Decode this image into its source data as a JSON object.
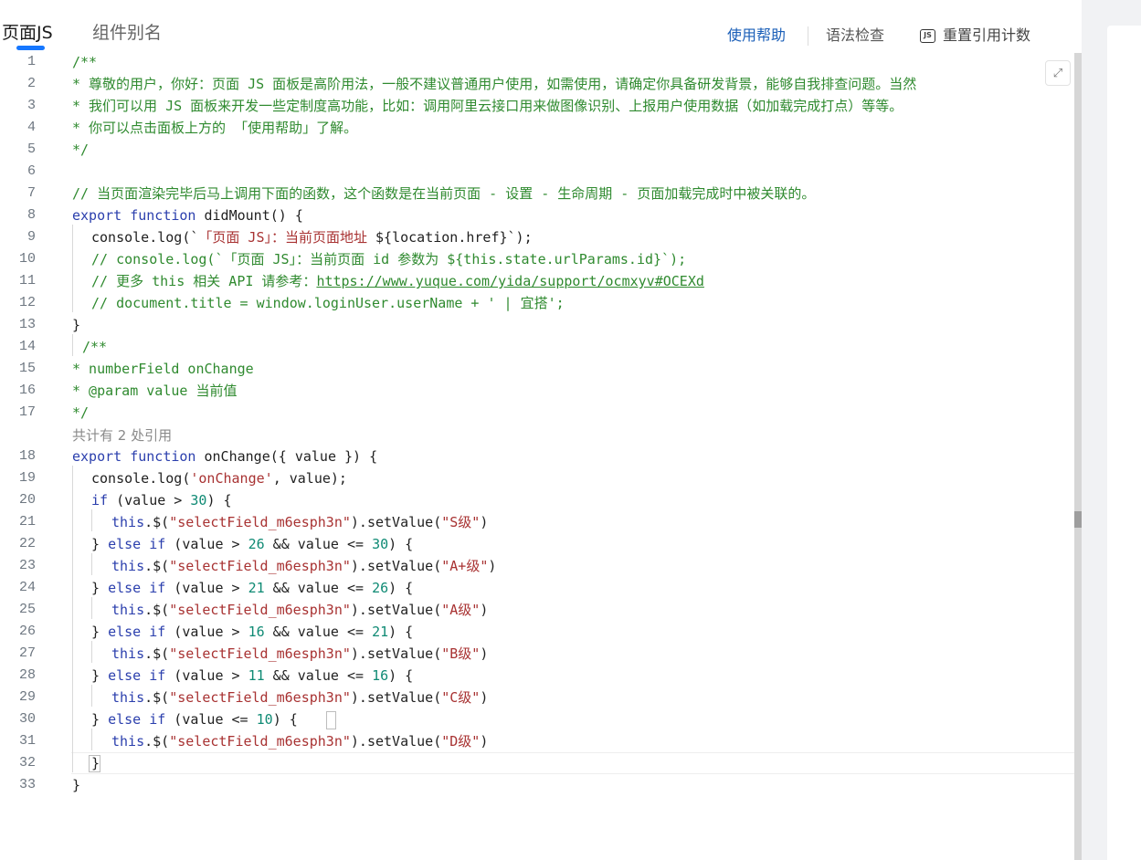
{
  "tabs": [
    {
      "label": "页面JS",
      "active": true
    },
    {
      "label": "组件别名",
      "active": false
    }
  ],
  "toolbar": {
    "help": "使用帮助",
    "lint": "语法检查",
    "reset_icon_text": "JS",
    "reset": "重置引用计数"
  },
  "code_lens": "共计有 2 处引用",
  "line_numbers": [
    "1",
    "2",
    "3",
    "4",
    "5",
    "6",
    "7",
    "8",
    "9",
    "10",
    "11",
    "12",
    "13",
    "14",
    "15",
    "16",
    "17",
    "18",
    "19",
    "20",
    "21",
    "22",
    "23",
    "24",
    "25",
    "26",
    "27",
    "28",
    "29",
    "30",
    "31",
    "32",
    "33"
  ],
  "code": {
    "l1": "/**",
    "l2": "* 尊敬的用户，你好：页面 JS 面板是高阶用法，一般不建议普通用户使用，如需使用，请确定你具备研发背景，能够自我排查问题。当然",
    "l3": "* 我们可以用 JS 面板来开发一些定制度高功能，比如：调用阿里云接口用来做图像识别、上报用户使用数据（如加载完成打点）等等。",
    "l4": "* 你可以点击面板上方的 「使用帮助」了解。",
    "l5": "*/",
    "l7": "// 当页面渲染完毕后马上调用下面的函数，这个函数是在当前页面 - 设置 - 生命周期 - 页面加载完成时中被关联的。",
    "l8": [
      "export",
      " ",
      "function",
      " didMount() {"
    ],
    "l9": [
      "console.log(`",
      "「页面 JS」：当前页面地址 ",
      "${location.href}",
      "`);"
    ],
    "l10": "// console.log(`「页面 JS」：当前页面 id 参数为 ${this.state.urlParams.id}`);",
    "l11": [
      "// 更多 this 相关 API 请参考：",
      "https://www.yuque.com/yida/support/ocmxyv#OCEXd"
    ],
    "l12": "// document.title = window.loginUser.userName + ' | 宜搭';",
    "l13": "}",
    "l14": "/**",
    "l15": "* numberField onChange",
    "l16": "* @param value 当前值",
    "l17": "*/",
    "l18": [
      "export",
      " ",
      "function",
      " onChange({ value }) {"
    ],
    "l19": [
      "console.log(",
      "'onChange'",
      ", value);"
    ],
    "l20": [
      "if",
      " (value > ",
      "30",
      ") {"
    ],
    "l21": [
      "this",
      ".$(",
      "\"selectField_m6esph3n\"",
      ").setValue(",
      "\"S级\"",
      ")"
    ],
    "l22": [
      "} ",
      "else",
      " ",
      "if",
      " (value > ",
      "26",
      " && value <= ",
      "30",
      ") {"
    ],
    "l23": [
      "this",
      ".$(",
      "\"selectField_m6esph3n\"",
      ").setValue(",
      "\"A+级\"",
      ")"
    ],
    "l24": [
      "} ",
      "else",
      " ",
      "if",
      " (value > ",
      "21",
      " && value <= ",
      "26",
      ") {"
    ],
    "l25": [
      "this",
      ".$(",
      "\"selectField_m6esph3n\"",
      ").setValue(",
      "\"A级\"",
      ")"
    ],
    "l26": [
      "} ",
      "else",
      " ",
      "if",
      " (value > ",
      "16",
      " && value <= ",
      "21",
      ") {"
    ],
    "l27": [
      "this",
      ".$(",
      "\"selectField_m6esph3n\"",
      ").setValue(",
      "\"B级\"",
      ")"
    ],
    "l28": [
      "} ",
      "else",
      " ",
      "if",
      " (value > ",
      "11",
      " && value <= ",
      "16",
      ") {"
    ],
    "l29": [
      "this",
      ".$(",
      "\"selectField_m6esph3n\"",
      ").setValue(",
      "\"C级\"",
      ")"
    ],
    "l30": [
      "} ",
      "else",
      " ",
      "if",
      " (value <= ",
      "10",
      ") ",
      "{"
    ],
    "l31": [
      "this",
      ".$(",
      "\"selectField_m6esph3n\"",
      ").setValue(",
      "\"D级\"",
      ")"
    ],
    "l32": "}",
    "l33": "}"
  },
  "colors": {
    "accent": "#1677ff",
    "comment": "#2f8a2f",
    "keyword": "#2b3fad",
    "string": "#a83232",
    "number": "#0f8a74"
  }
}
